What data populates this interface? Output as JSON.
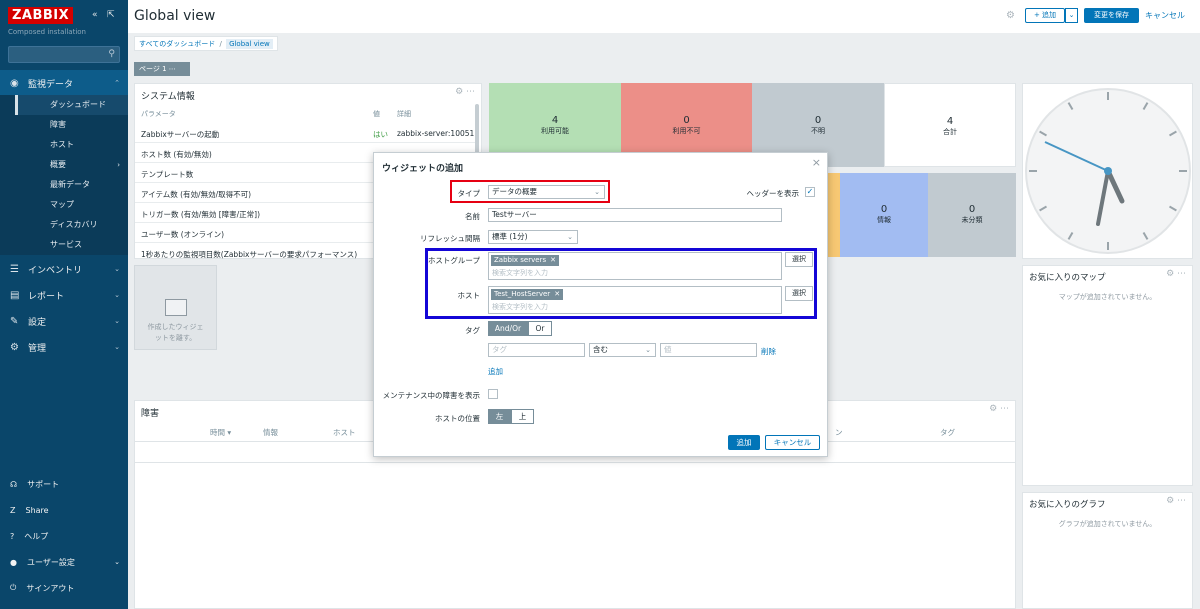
{
  "sidebar": {
    "logo": "ZABBIX",
    "subtitle": "Composed installation",
    "collapse_icon": "«",
    "expand_icon": "⇱",
    "search_icon": "⚲",
    "nav": [
      {
        "label": "監視データ",
        "icon": "eye-icon",
        "active": true
      },
      {
        "label": "インベントリ",
        "icon": "list-icon"
      },
      {
        "label": "レポート",
        "icon": "chart-icon"
      },
      {
        "label": "設定",
        "icon": "wrench-icon"
      },
      {
        "label": "管理",
        "icon": "gear-icon"
      }
    ],
    "submenu": [
      "ダッシュボード",
      "障害",
      "ホスト",
      "概要",
      "最新データ",
      "マップ",
      "ディスカバリ",
      "サービス"
    ],
    "bottom": [
      "サポート",
      "Share",
      "ヘルプ",
      "ユーザー設定",
      "サインアウト"
    ]
  },
  "header": {
    "title": "Global view",
    "add_label": "+ 追加",
    "save_label": "変更を保存",
    "cancel_label": "キャンセル"
  },
  "breadcrumb": {
    "root": "すべてのダッシュボード",
    "sep": "/",
    "current": "Global view"
  },
  "page_tab": "ページ 1 ⋯",
  "system_info": {
    "title": "システム情報",
    "headers": {
      "param": "パラメータ",
      "value": "値",
      "detail": "詳細"
    },
    "rows": [
      {
        "p": "Zabbixサーバーの起動",
        "v": "はい",
        "d": "zabbix-server:10051"
      },
      {
        "p": "ホスト数 (有効/無効)",
        "v": "",
        "d": ""
      },
      {
        "p": "テンプレート数",
        "v": "",
        "d": ""
      },
      {
        "p": "アイテム数 (有効/無効/取得不可)",
        "v": "",
        "d": ""
      },
      {
        "p": "トリガー数 (有効/無効 [障害/正常])",
        "v": "",
        "d": ""
      },
      {
        "p": "ユーザー数 (オンライン)",
        "v": "",
        "d": ""
      },
      {
        "p": "1秒あたりの監視項目数(Zabbixサーバーの要求パフォーマンス)",
        "v": "",
        "d": ""
      }
    ]
  },
  "availability": [
    {
      "n": "4",
      "l": "利用可能",
      "color": "#b4dfb4"
    },
    {
      "n": "0",
      "l": "利用不可",
      "color": "#ec8f88"
    },
    {
      "n": "0",
      "l": "不明",
      "color": "#c1cad0"
    },
    {
      "n": "4",
      "l": "合計",
      "color": "#ffffff"
    }
  ],
  "severity": [
    {
      "n": "0",
      "l": "情報",
      "color": "#a2bcf2"
    },
    {
      "n": "0",
      "l": "未分類",
      "color": "#c1cad0"
    }
  ],
  "empty_widget": {
    "line1": "作成したウィジェ",
    "line2": "ットを離す。"
  },
  "problems": {
    "title": "障害",
    "cols": [
      "時間 ▾",
      "情報",
      "ホスト",
      "ン",
      "タグ"
    ]
  },
  "fav_maps": {
    "title": "お気に入りのマップ",
    "empty": "マップが追加されていません。"
  },
  "fav_graphs": {
    "title": "お気に入りのグラフ",
    "empty": "グラフが追加されていません。"
  },
  "dialog": {
    "title": "ウィジェットの追加",
    "type_label": "タイプ",
    "type_value": "データの概要",
    "show_header_label": "ヘッダーを表示",
    "name_label": "名前",
    "name_value": "Testサーバー",
    "refresh_label": "リフレッシュ間隔",
    "refresh_value": "標準 (1分)",
    "hostgroup_label": "ホストグループ",
    "hostgroup_chip": "Zabbix servers",
    "host_label": "ホスト",
    "host_chip": "Test_HostServer",
    "search_placeholder": "検索文字列を入力",
    "select_label": "選択",
    "tag_label": "タグ",
    "andor": "And/Or",
    "or": "Or",
    "tag_placeholder": "タグ",
    "op_value": "含む",
    "value_placeholder": "値",
    "remove_label": "削除",
    "add_label": "追加",
    "maintenance_label": "メンテナンス中の障害を表示",
    "host_pos_label": "ホストの位置",
    "left": "左",
    "top": "上",
    "submit": "追加",
    "cancel": "キャンセル"
  },
  "colors": {
    "sidebar": "#0a466a",
    "accent": "#0275b8",
    "highlight_red": "#e60012",
    "highlight_blue": "#1406d6"
  }
}
